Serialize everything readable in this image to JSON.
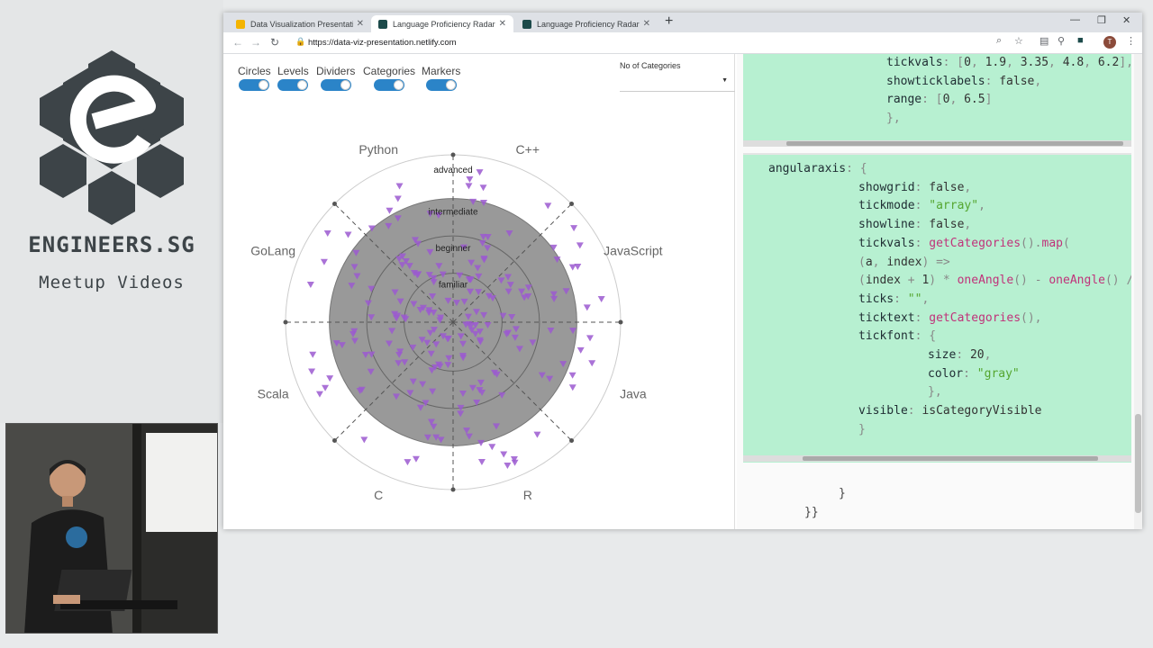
{
  "brand": {
    "name": "ENGINEERS.SG",
    "tagline": "Meetup Videos"
  },
  "tabs": [
    {
      "title": "Data Visualization Presentation",
      "active": false
    },
    {
      "title": "Language Proficiency Radar",
      "active": true
    },
    {
      "title": "Language Proficiency Radar",
      "active": false
    }
  ],
  "address": {
    "url": "https://data-viz-presentation.netlify.com"
  },
  "controls": {
    "toggles": [
      {
        "label": "Circles",
        "on": true
      },
      {
        "label": "Levels",
        "on": true
      },
      {
        "label": "Dividers",
        "on": true
      },
      {
        "label": "Categories",
        "on": true
      },
      {
        "label": "Markers",
        "on": true
      }
    ],
    "categories_label": "No of Categories",
    "categories_value": ""
  },
  "radar": {
    "categories": [
      "C++",
      "JavaScript",
      "Java",
      "R",
      "C",
      "Scala",
      "GoLang",
      "Python"
    ],
    "levels": [
      "advanced",
      "intermediate",
      "beginner",
      "familiar"
    ],
    "level_radii": [
      6.5,
      4.8,
      3.35,
      1.9
    ],
    "marker_color": "#9b59d0",
    "fill_color": "#999999"
  },
  "code": {
    "top_lines": [
      [
        [
          "tickvals",
          "k"
        ],
        [
          ": [",
          "p"
        ],
        [
          "0",
          "n"
        ],
        [
          ", ",
          "p"
        ],
        [
          "1.9",
          "n"
        ],
        [
          ", ",
          "p"
        ],
        [
          "3.35",
          "n"
        ],
        [
          ", ",
          "p"
        ],
        [
          "4.8",
          "n"
        ],
        [
          ", ",
          "p"
        ],
        [
          "6.2",
          "n"
        ],
        [
          "],",
          "p"
        ]
      ],
      [
        [
          "showticklabels",
          "k"
        ],
        [
          ": ",
          "p"
        ],
        [
          "false",
          "b"
        ],
        [
          ",",
          "p"
        ]
      ],
      [
        [
          "range",
          "k"
        ],
        [
          ": [",
          "p"
        ],
        [
          "0",
          "n"
        ],
        [
          ", ",
          "p"
        ],
        [
          "6.5",
          "n"
        ],
        [
          "]",
          "p"
        ]
      ],
      [
        [
          "},",
          "p"
        ]
      ]
    ],
    "main_lines": [
      [
        [
          "angularaxis",
          "k"
        ],
        [
          ": {",
          "p"
        ]
      ],
      [
        [
          "showgrid",
          "k"
        ],
        [
          ": ",
          "p"
        ],
        [
          "false",
          "b"
        ],
        [
          ",",
          "p"
        ]
      ],
      [
        [
          "tickmode",
          "k"
        ],
        [
          ": ",
          "p"
        ],
        [
          "\"array\"",
          "s"
        ],
        [
          ",",
          "p"
        ]
      ],
      [
        [
          "showline",
          "k"
        ],
        [
          ": ",
          "p"
        ],
        [
          "false",
          "b"
        ],
        [
          ",",
          "p"
        ]
      ],
      [
        [
          "tickvals",
          "k"
        ],
        [
          ": ",
          "p"
        ],
        [
          "getCategories",
          "f"
        ],
        [
          "().",
          "p"
        ],
        [
          "map",
          "f"
        ],
        [
          "(",
          "p"
        ]
      ],
      [
        [
          "(",
          "p"
        ],
        [
          "a",
          "b"
        ],
        [
          ", ",
          "p"
        ],
        [
          "index",
          "b"
        ],
        [
          ") =>",
          "p"
        ]
      ],
      [
        [
          "(",
          "p"
        ],
        [
          "index",
          "b"
        ],
        [
          " + ",
          "p"
        ],
        [
          "1",
          "n"
        ],
        [
          ") * ",
          "p"
        ],
        [
          "oneAngle",
          "f"
        ],
        [
          "() - ",
          "p"
        ],
        [
          "oneAngle",
          "f"
        ],
        [
          "() /",
          "p"
        ]
      ],
      [
        [
          "ticks",
          "k"
        ],
        [
          ": ",
          "p"
        ],
        [
          "\"\"",
          "s"
        ],
        [
          ",",
          "p"
        ]
      ],
      [
        [
          "ticktext",
          "k"
        ],
        [
          ": ",
          "p"
        ],
        [
          "getCategories",
          "f"
        ],
        [
          "(),",
          "p"
        ]
      ],
      [
        [
          "tickfont",
          "k"
        ],
        [
          ": {",
          "p"
        ]
      ],
      [
        [
          "size",
          "k"
        ],
        [
          ": ",
          "p"
        ],
        [
          "20",
          "n"
        ],
        [
          ",",
          "p"
        ]
      ],
      [
        [
          "color",
          "k"
        ],
        [
          ": ",
          "p"
        ],
        [
          "\"gray\"",
          "s"
        ]
      ],
      [
        [
          "},",
          "p"
        ]
      ],
      [
        [
          "visible",
          "k"
        ],
        [
          ": ",
          "p"
        ],
        [
          "isCategoryVisible",
          "b"
        ]
      ],
      [
        [
          "}",
          "p"
        ]
      ]
    ],
    "bottom_lines": [
      "}",
      "}}"
    ]
  }
}
